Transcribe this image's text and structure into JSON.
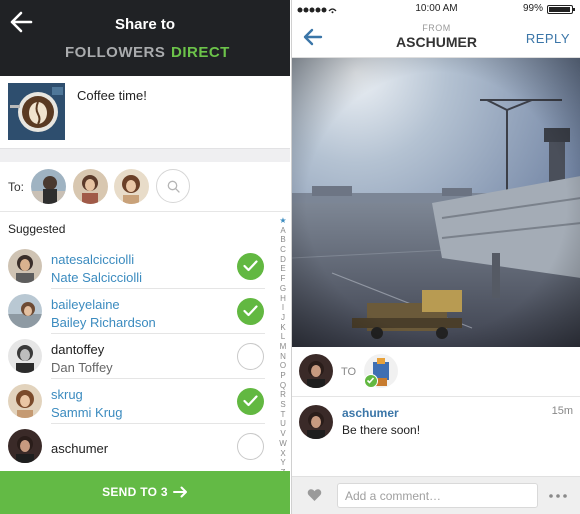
{
  "left": {
    "header": {
      "title": "Share to",
      "tab_followers": "FOLLOWERS",
      "tab_direct": "DIRECT",
      "active_tab": "DIRECT"
    },
    "post": {
      "caption": "Coffee time!"
    },
    "to_label": "To:",
    "suggested_label": "Suggested",
    "users": [
      {
        "username": "natesalcicciolli",
        "fullname": "Nate Salcicciolli",
        "selected": true
      },
      {
        "username": "baileyelaine",
        "fullname": "Bailey Richardson",
        "selected": true
      },
      {
        "username": "dantoffey",
        "fullname": "Dan Toffey",
        "selected": false
      },
      {
        "username": "skrug",
        "fullname": "Sammi Krug",
        "selected": true
      },
      {
        "username": "aschumer",
        "fullname": "",
        "selected": false
      }
    ],
    "alphabet": [
      "★",
      "A",
      "B",
      "C",
      "D",
      "E",
      "F",
      "G",
      "H",
      "I",
      "J",
      "K",
      "L",
      "M",
      "N",
      "O",
      "P",
      "Q",
      "R",
      "S",
      "T",
      "U",
      "V",
      "W",
      "X",
      "Y",
      "Z"
    ],
    "send_label": "SEND TO 3",
    "colors": {
      "header_bg": "#202225",
      "accent_green": "#63ba45",
      "link_blue": "#3b8bbf"
    }
  },
  "right": {
    "status": {
      "time": "10:00 AM",
      "battery": "99%"
    },
    "nav": {
      "from_label": "FROM",
      "sender": "ASCHUMER",
      "reply_label": "REPLY"
    },
    "to_label": "TO",
    "comment": {
      "username": "aschumer",
      "text": "Be there soon!",
      "time_ago": "15m"
    },
    "comment_input": {
      "placeholder": "Add a comment…"
    },
    "colors": {
      "link_blue": "#3b76a8"
    }
  }
}
